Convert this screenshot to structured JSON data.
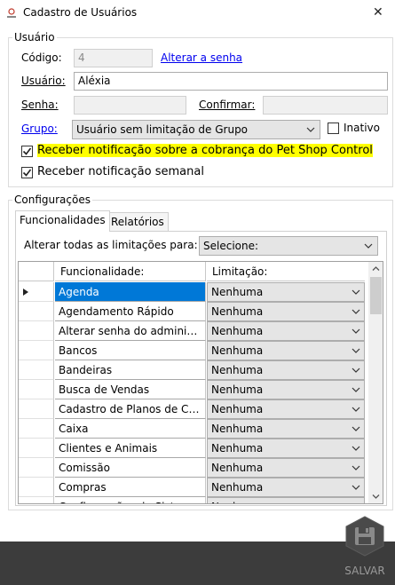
{
  "window": {
    "title": "Cadastro de Usuários",
    "close": "✕"
  },
  "usuario_group": {
    "legend": "Usuário",
    "codigo_label": "Código:",
    "codigo_value": "4",
    "alterar_senha": "Alterar a senha",
    "usuario_label": "Usuário:",
    "usuario_value": "Aléxia",
    "senha_label": "Senha:",
    "senha_value": "",
    "confirmar_label": "Confirmar:",
    "confirmar_value": "",
    "grupo_label": "Grupo:",
    "grupo_value": "Usuário sem limitação de Grupo",
    "inativo_label": "Inativo",
    "inativo_checked": false,
    "notif_cobranca_label": "Receber notificação sobre a cobrança do Pet Shop Control",
    "notif_cobranca_checked": true,
    "notif_semanal_label": "Receber notificação semanal",
    "notif_semanal_checked": true
  },
  "config_group": {
    "legend": "Configurações",
    "tabs": [
      {
        "label": "Funcionalidades",
        "active": true
      },
      {
        "label": "Relatórios",
        "active": false
      }
    ],
    "alterar_todas_label": "Alterar todas as limitações para:",
    "alterar_todas_value": "Selecione:",
    "grid": {
      "columns": [
        "Funcionalidade:",
        "Limitação:"
      ],
      "rows": [
        {
          "funcionalidade": "Agenda",
          "limitacao": "Nenhuma"
        },
        {
          "funcionalidade": "Agendamento Rápido",
          "limitacao": "Nenhuma"
        },
        {
          "funcionalidade": "Alterar senha do administrador",
          "limitacao": "Nenhuma"
        },
        {
          "funcionalidade": "Bancos",
          "limitacao": "Nenhuma"
        },
        {
          "funcionalidade": "Bandeiras",
          "limitacao": "Nenhuma"
        },
        {
          "funcionalidade": "Busca de Vendas",
          "limitacao": "Nenhuma"
        },
        {
          "funcionalidade": "Cadastro de Planos de Contas",
          "limitacao": "Nenhuma"
        },
        {
          "funcionalidade": "Caixa",
          "limitacao": "Nenhuma"
        },
        {
          "funcionalidade": "Clientes e Animais",
          "limitacao": "Nenhuma"
        },
        {
          "funcionalidade": "Comissão",
          "limitacao": "Nenhuma"
        },
        {
          "funcionalidade": "Compras",
          "limitacao": "Nenhuma"
        },
        {
          "funcionalidade": "Configurações do Sistema",
          "limitacao": "Nenhuma"
        }
      ]
    }
  },
  "footer": {
    "save_label": "SALVAR"
  },
  "colors": {
    "accent": "#0078d7",
    "highlight": "#ffff00",
    "footer": "#3c3c3c",
    "link": "#0000ee"
  }
}
